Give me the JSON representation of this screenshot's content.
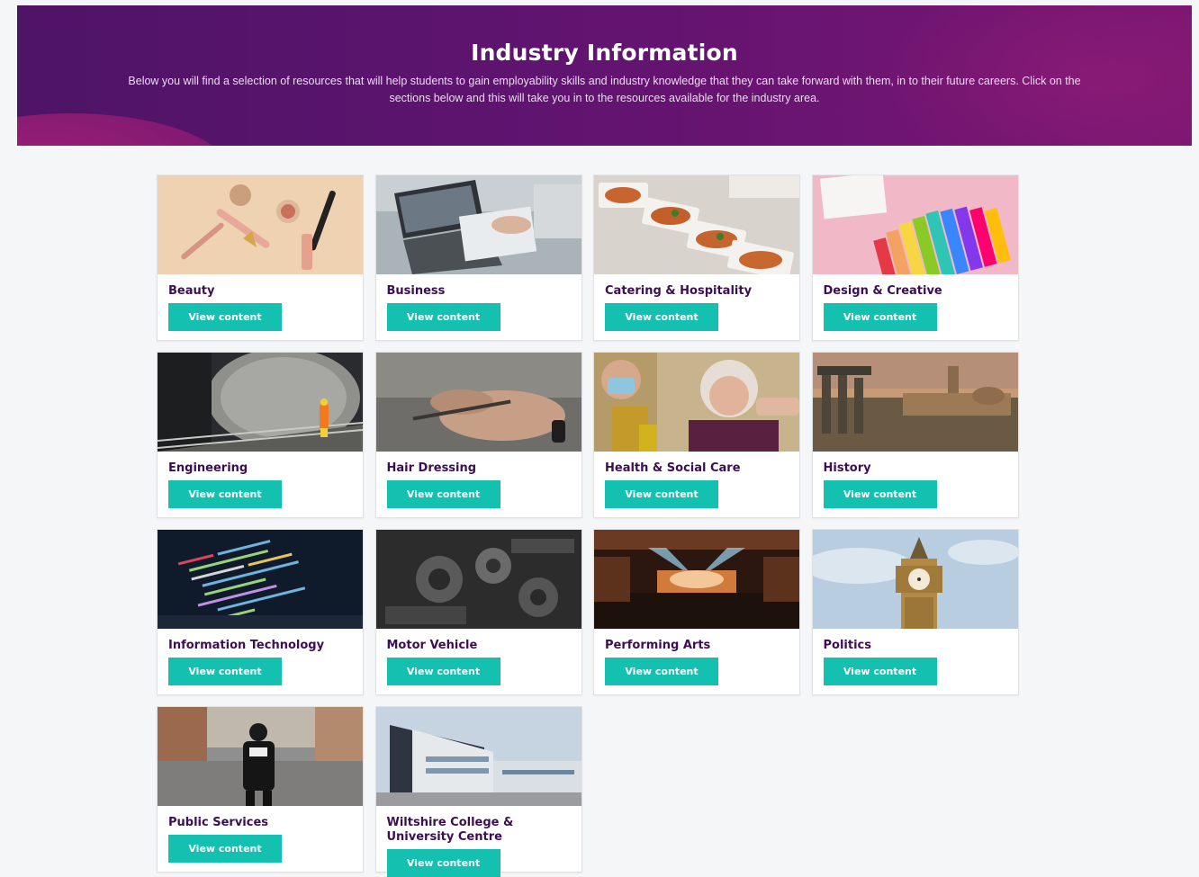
{
  "hero": {
    "title": "Industry Information",
    "description": "Below you will find a selection of resources that will help students to gain employability skills and industry knowledge that they can take forward with them, in to their future careers. Click on the sections below and this will take you in to the resources available for the industry area."
  },
  "button_label": "View content",
  "cards": [
    {
      "name": "Beauty"
    },
    {
      "name": "Business"
    },
    {
      "name": "Catering & Hospitality"
    },
    {
      "name": "Design & Creative"
    },
    {
      "name": "Engineering"
    },
    {
      "name": "Hair Dressing"
    },
    {
      "name": "Health & Social Care"
    },
    {
      "name": "History"
    },
    {
      "name": "Information Technology"
    },
    {
      "name": "Motor Vehicle"
    },
    {
      "name": "Performing Arts"
    },
    {
      "name": "Politics"
    },
    {
      "name": "Public Services"
    },
    {
      "name": "Wiltshire College & University Centre"
    }
  ],
  "colors": {
    "accent": "#14c1b0",
    "heading": "#3b0f52",
    "hero": "#5f1470"
  }
}
